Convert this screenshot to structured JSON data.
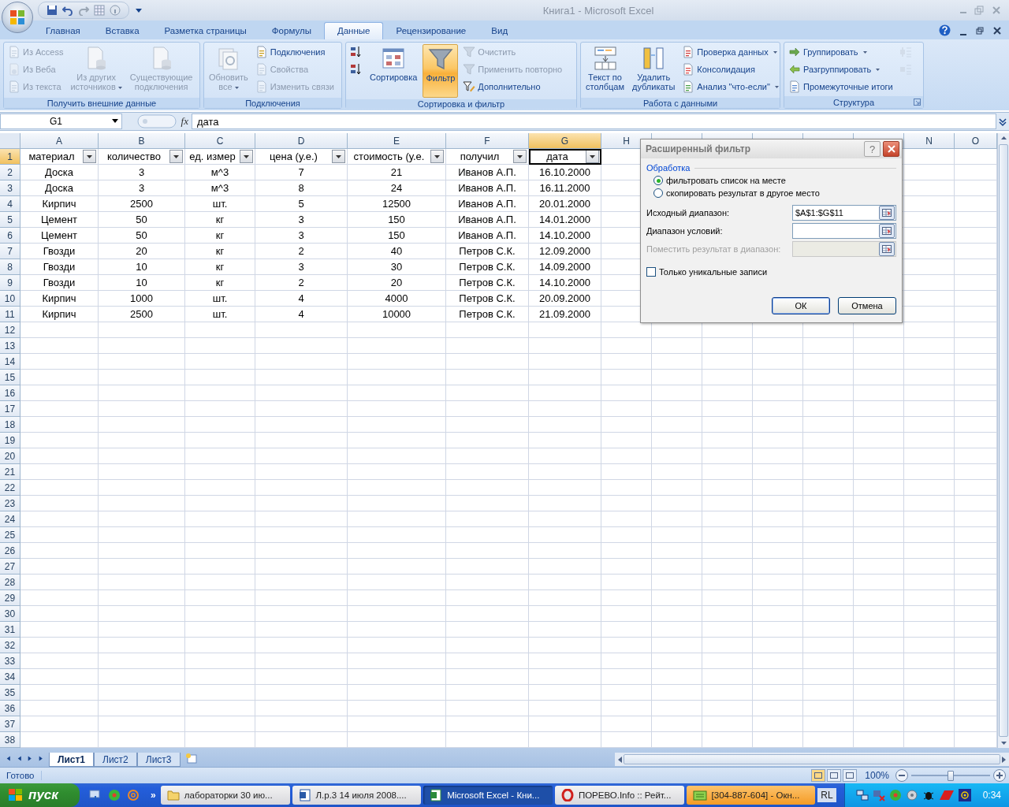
{
  "window": {
    "title": "Книга1 - Microsoft Excel"
  },
  "ribbon_tabs": [
    {
      "label": "Главная",
      "selected": false
    },
    {
      "label": "Вставка",
      "selected": false
    },
    {
      "label": "Разметка страницы",
      "selected": false
    },
    {
      "label": "Формулы",
      "selected": false
    },
    {
      "label": "Данные",
      "selected": true
    },
    {
      "label": "Рецензирование",
      "selected": false
    },
    {
      "label": "Вид",
      "selected": false
    }
  ],
  "ribbon_groups": [
    {
      "title": "Получить внешние данные",
      "launcher": false,
      "columns": [
        [
          {
            "label": "Из Access",
            "kind": "small",
            "disabled": true,
            "dropdown": false
          },
          {
            "label": "Из Веба",
            "kind": "small",
            "disabled": true,
            "dropdown": false
          },
          {
            "label": "Из текста",
            "kind": "small",
            "disabled": true,
            "dropdown": false
          }
        ],
        [
          {
            "label": "Из других\nисточников",
            "kind": "large",
            "disabled": true,
            "dropdown": true
          }
        ],
        [
          {
            "label": "Существующие\nподключения",
            "kind": "large",
            "disabled": true,
            "dropdown": false
          }
        ]
      ]
    },
    {
      "title": "Подключения",
      "launcher": false,
      "columns": [
        [
          {
            "label": "Обновить\nвсе",
            "kind": "large",
            "disabled": true,
            "dropdown": true
          }
        ],
        [
          {
            "label": "Подключения",
            "kind": "small",
            "disabled": false,
            "dropdown": false
          },
          {
            "label": "Свойства",
            "kind": "small",
            "disabled": true,
            "dropdown": false
          },
          {
            "label": "Изменить связи",
            "kind": "small",
            "disabled": true,
            "dropdown": false
          }
        ]
      ]
    },
    {
      "title": "Сортировка и фильтр",
      "launcher": false,
      "columns": [
        [
          {
            "kind": "small",
            "disabled": false,
            "dropdown": false
          },
          {
            "kind": "small",
            "disabled": false,
            "dropdown": false
          }
        ],
        [
          {
            "label": "Сортировка",
            "kind": "large",
            "disabled": false,
            "dropdown": false
          }
        ],
        [
          {
            "label": "Фильтр",
            "kind": "large",
            "disabled": false,
            "dropdown": false,
            "on": true
          }
        ],
        [
          {
            "label": "Очистить",
            "kind": "small",
            "disabled": true,
            "dropdown": false
          },
          {
            "label": "Применить повторно",
            "kind": "small",
            "disabled": true,
            "dropdown": false
          },
          {
            "label": "Дополнительно",
            "kind": "small",
            "disabled": false,
            "dropdown": false
          }
        ]
      ]
    },
    {
      "title": "Работа с данными",
      "launcher": false,
      "columns": [
        [
          {
            "label": "Текст по\nстолбцам",
            "kind": "large",
            "disabled": false,
            "dropdown": false
          }
        ],
        [
          {
            "label": "Удалить\nдубликаты",
            "kind": "large",
            "disabled": false,
            "dropdown": false
          }
        ],
        [
          {
            "label": "Проверка данных",
            "kind": "small",
            "disabled": false,
            "dropdown": true
          },
          {
            "label": "Консолидация",
            "kind": "small",
            "disabled": false,
            "dropdown": false
          },
          {
            "label": "Анализ \"что-если\"",
            "kind": "small",
            "disabled": false,
            "dropdown": true
          }
        ]
      ]
    },
    {
      "title": "Структура",
      "launcher": true,
      "columns": [
        [
          {
            "label": "Группировать",
            "kind": "small",
            "disabled": false,
            "dropdown": true
          },
          {
            "label": "Разгруппировать",
            "kind": "small",
            "disabled": false,
            "dropdown": true
          },
          {
            "label": "Промежуточные итоги",
            "kind": "small",
            "disabled": false,
            "dropdown": false
          }
        ],
        [
          {
            "kind": "small",
            "disabled": true,
            "dropdown": false
          },
          {
            "kind": "small",
            "disabled": true,
            "dropdown": false
          }
        ]
      ]
    }
  ],
  "formula_bar": {
    "name_box": "G1",
    "function_label": "fx",
    "formula": "дата"
  },
  "columns": [
    {
      "letter": "A",
      "selected": false
    },
    {
      "letter": "B",
      "selected": false
    },
    {
      "letter": "C",
      "selected": false
    },
    {
      "letter": "D",
      "selected": false
    },
    {
      "letter": "E",
      "selected": false
    },
    {
      "letter": "F",
      "selected": false
    },
    {
      "letter": "G",
      "selected": true
    },
    {
      "letter": "H",
      "selected": false
    },
    {
      "letter": "N",
      "selected": false
    },
    {
      "letter": "O",
      "selected": false
    }
  ],
  "rows": [
    {
      "number": "1",
      "selected": true,
      "cells": [
        {
          "text": "материал",
          "filter": true
        },
        {
          "text": "количество",
          "filter": true
        },
        {
          "text": "ед. измер",
          "filter": true
        },
        {
          "text": "цена (у.е.)",
          "filter": true
        },
        {
          "text": "стоимость (у.е.",
          "filter": true
        },
        {
          "text": "получил",
          "filter": true
        },
        {
          "text": "дата",
          "filter": true
        }
      ]
    },
    {
      "number": "2",
      "selected": false,
      "cells": [
        {
          "text": "Доска"
        },
        {
          "text": "3"
        },
        {
          "text": "м^3"
        },
        {
          "text": "7"
        },
        {
          "text": "21"
        },
        {
          "text": "Иванов А.П."
        },
        {
          "text": "16.10.2000"
        }
      ]
    },
    {
      "number": "3",
      "selected": false,
      "cells": [
        {
          "text": "Доска"
        },
        {
          "text": "3"
        },
        {
          "text": "м^3"
        },
        {
          "text": "8"
        },
        {
          "text": "24"
        },
        {
          "text": "Иванов А.П."
        },
        {
          "text": "16.11.2000"
        }
      ]
    },
    {
      "number": "4",
      "selected": false,
      "cells": [
        {
          "text": "Кирпич"
        },
        {
          "text": "2500"
        },
        {
          "text": "шт."
        },
        {
          "text": "5"
        },
        {
          "text": "12500"
        },
        {
          "text": "Иванов А.П."
        },
        {
          "text": "20.01.2000"
        }
      ]
    },
    {
      "number": "5",
      "selected": false,
      "cells": [
        {
          "text": "Цемент"
        },
        {
          "text": "50"
        },
        {
          "text": "кг"
        },
        {
          "text": "3"
        },
        {
          "text": "150"
        },
        {
          "text": "Иванов А.П."
        },
        {
          "text": "14.01.2000"
        }
      ]
    },
    {
      "number": "6",
      "selected": false,
      "cells": [
        {
          "text": "Цемент"
        },
        {
          "text": "50"
        },
        {
          "text": "кг"
        },
        {
          "text": "3"
        },
        {
          "text": "150"
        },
        {
          "text": "Иванов А.П."
        },
        {
          "text": "14.10.2000"
        }
      ]
    },
    {
      "number": "7",
      "selected": false,
      "cells": [
        {
          "text": "Гвозди"
        },
        {
          "text": "20"
        },
        {
          "text": "кг"
        },
        {
          "text": "2"
        },
        {
          "text": "40"
        },
        {
          "text": "Петров С.К."
        },
        {
          "text": "12.09.2000"
        }
      ]
    },
    {
      "number": "8",
      "selected": false,
      "cells": [
        {
          "text": "Гвозди"
        },
        {
          "text": "10"
        },
        {
          "text": "кг"
        },
        {
          "text": "3"
        },
        {
          "text": "30"
        },
        {
          "text": "Петров С.К."
        },
        {
          "text": "14.09.2000"
        }
      ]
    },
    {
      "number": "9",
      "selected": false,
      "cells": [
        {
          "text": "Гвозди"
        },
        {
          "text": "10"
        },
        {
          "text": "кг"
        },
        {
          "text": "2"
        },
        {
          "text": "20"
        },
        {
          "text": "Петров С.К."
        },
        {
          "text": "14.10.2000"
        }
      ]
    },
    {
      "number": "10",
      "selected": false,
      "cells": [
        {
          "text": "Кирпич"
        },
        {
          "text": "1000"
        },
        {
          "text": "шт."
        },
        {
          "text": "4"
        },
        {
          "text": "4000"
        },
        {
          "text": "Петров С.К."
        },
        {
          "text": "20.09.2000"
        }
      ]
    },
    {
      "number": "11",
      "selected": false,
      "cells": [
        {
          "text": "Кирпич"
        },
        {
          "text": "2500"
        },
        {
          "text": "шт."
        },
        {
          "text": "4"
        },
        {
          "text": "10000"
        },
        {
          "text": "Петров С.К."
        },
        {
          "text": "21.09.2000"
        }
      ]
    },
    {
      "number": "12",
      "selected": false
    },
    {
      "number": "13",
      "selected": false
    },
    {
      "number": "14",
      "selected": false
    },
    {
      "number": "15",
      "selected": false
    },
    {
      "number": "16",
      "selected": false
    },
    {
      "number": "17",
      "selected": false
    },
    {
      "number": "18",
      "selected": false
    },
    {
      "number": "19",
      "selected": false
    },
    {
      "number": "20",
      "selected": false
    },
    {
      "number": "21",
      "selected": false
    },
    {
      "number": "22",
      "selected": false
    },
    {
      "number": "23",
      "selected": false
    },
    {
      "number": "24",
      "selected": false
    },
    {
      "number": "25",
      "selected": false
    },
    {
      "number": "26",
      "selected": false
    },
    {
      "number": "27",
      "selected": false
    },
    {
      "number": "28",
      "selected": false
    },
    {
      "number": "29",
      "selected": false
    },
    {
      "number": "30",
      "selected": false
    },
    {
      "number": "31",
      "selected": false
    },
    {
      "number": "32",
      "selected": false
    },
    {
      "number": "33",
      "selected": false
    },
    {
      "number": "34",
      "selected": false
    },
    {
      "number": "35",
      "selected": false
    },
    {
      "number": "36",
      "selected": false
    },
    {
      "number": "37",
      "selected": false
    },
    {
      "number": "38",
      "selected": false
    }
  ],
  "advanced_filter_dialog": {
    "title": "Расширенный фильтр",
    "help_label": "?",
    "group_label": "Обработка",
    "options": [
      {
        "label": "фильтровать список на месте",
        "selected": true
      },
      {
        "label": "скопировать результат в другое место",
        "selected": false
      }
    ],
    "fields": [
      {
        "label": "Исходный диапазон:",
        "value": "$A$1:$G$11",
        "disabled": false
      },
      {
        "label": "Диапазон условий:",
        "disabled": false
      },
      {
        "label": "Поместить результат в диапазон:",
        "disabled": true
      }
    ],
    "unique_only": {
      "label": "Только уникальные записи",
      "checked": false
    },
    "buttons": [
      {
        "label": "ОК",
        "default": true
      },
      {
        "label": "Отмена",
        "default": false
      }
    ]
  },
  "sheet_tabs": [
    {
      "label": "Лист1",
      "selected": true
    },
    {
      "label": "Лист2",
      "selected": false
    },
    {
      "label": "Лист3",
      "selected": false
    }
  ],
  "status_bar": {
    "text": "Готово",
    "views": [
      {
        "selected": true
      },
      {
        "selected": false
      },
      {
        "selected": false
      }
    ],
    "zoom": "100%",
    "zoom_slider": {
      "level": 0.5
    }
  },
  "taskbar": {
    "start": "пуск",
    "more": "»",
    "tasks": [
      {
        "label": "лабораторки 30 ию...",
        "kind": "folder",
        "selected": false,
        "flashing": false
      },
      {
        "label": "Л.р.3 14 июля 2008....",
        "kind": "document",
        "selected": false,
        "flashing": false
      },
      {
        "label": "Microsoft Excel - Кни...",
        "kind": "spreadsheet",
        "selected": true,
        "flashing": false
      },
      {
        "label": "ПОРЕВО.Info :: Рейт...",
        "kind": "browser",
        "selected": false,
        "flashing": false
      },
      {
        "label": "[304-887-604] - Окн...",
        "kind": "chat",
        "selected": false,
        "flashing": true
      }
    ],
    "language": "RL",
    "clock": "0:34"
  }
}
